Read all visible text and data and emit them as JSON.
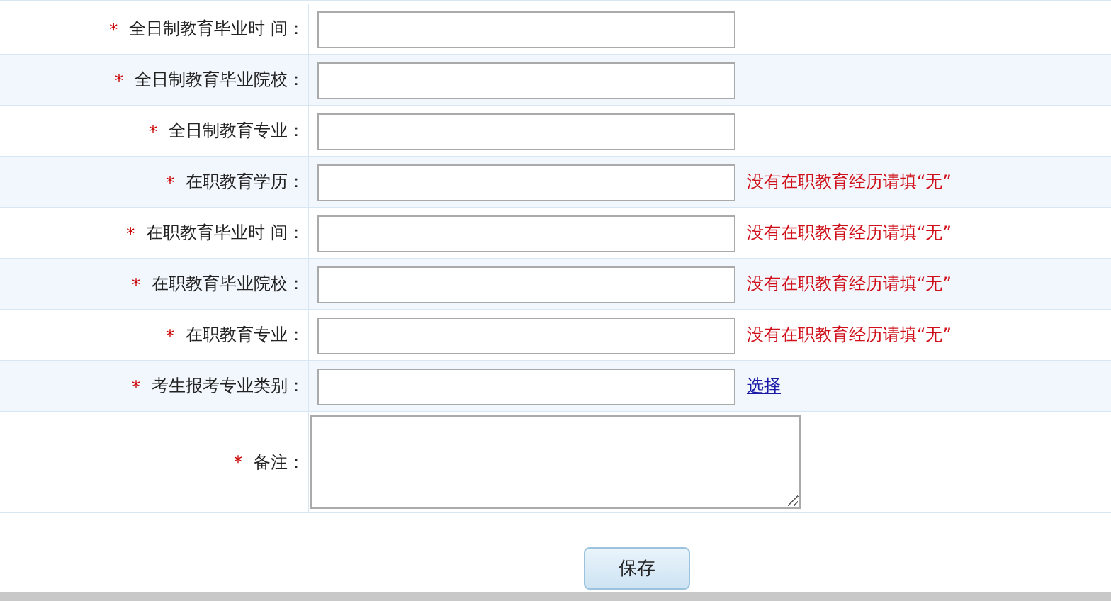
{
  "form": {
    "rows": [
      {
        "mark": "*",
        "label": "全日制教育毕业时 间：",
        "kind": "input"
      },
      {
        "mark": "*",
        "label": "全日制教育毕业院校：",
        "kind": "input"
      },
      {
        "mark": "*",
        "label": "全日制教育专业：",
        "kind": "input"
      },
      {
        "mark": "*",
        "label": "在职教育学历：",
        "kind": "input",
        "hint": {
          "kind": "note",
          "text": "没有在职教育经历请填“无”"
        }
      },
      {
        "mark": "*",
        "label": "在职教育毕业时 间：",
        "kind": "input",
        "hint": {
          "kind": "note",
          "text": "没有在职教育经历请填“无”"
        }
      },
      {
        "mark": "*",
        "label": "在职教育毕业院校：",
        "kind": "input",
        "hint": {
          "kind": "note",
          "text": "没有在职教育经历请填“无”"
        }
      },
      {
        "mark": "*",
        "label": "在职教育专业：",
        "kind": "input",
        "hint": {
          "kind": "note",
          "text": "没有在职教育经历请填“无”"
        }
      },
      {
        "mark": "*",
        "label": "考生报考专业类别：",
        "kind": "input",
        "hint": {
          "kind": "link",
          "text": "选择"
        }
      },
      {
        "mark": "*",
        "label": "备注：",
        "kind": "textarea"
      }
    ]
  },
  "save_button": "保存"
}
